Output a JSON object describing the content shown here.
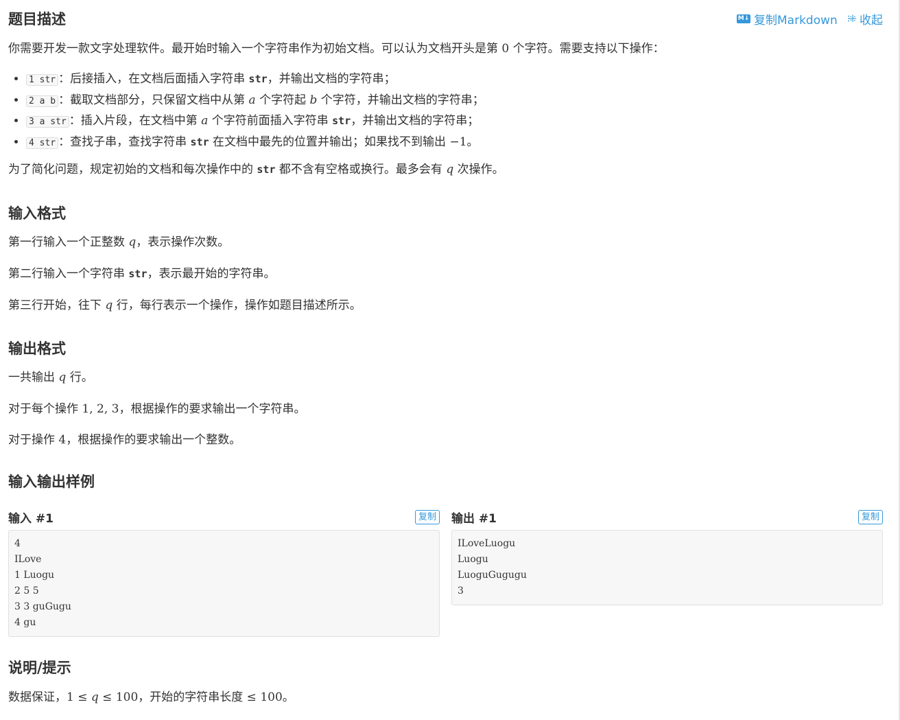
{
  "toolbar": {
    "copy_markdown": "复制Markdown",
    "collapse": "收起"
  },
  "desc": {
    "title": "题目描述",
    "intro": [
      "你需要开发一款文字处理软件。最开始时输入一个字符串作为初始文档。可以认为文档开头是第 ",
      "0",
      " 个字符。需要支持以下操作："
    ],
    "ops": [
      {
        "code": "1 str",
        "parts": [
          "：后接插入，在文档后面插入字符串 ",
          "str",
          "，并输出文档的字符串；"
        ]
      },
      {
        "code": "2 a b",
        "parts": [
          "：截取文档部分，只保留文档中从第 ",
          "a",
          " 个字符起 ",
          "b",
          " 个字符，并输出文档的字符串；"
        ]
      },
      {
        "code": "3 a str",
        "parts": [
          "：插入片段，在文档中第 ",
          "a",
          " 个字符前面插入字符串 ",
          "str",
          "，并输出文档的字符串；"
        ]
      },
      {
        "code": "4 str",
        "parts": [
          "：查找子串，查找字符串 ",
          "str",
          " 在文档中最先的位置并输出；如果找不到输出 ",
          "−1",
          "。"
        ]
      }
    ],
    "note": [
      "为了简化问题，规定初始的文档和每次操作中的 ",
      "str",
      " 都不含有空格或换行。最多会有 ",
      "q",
      " 次操作。"
    ]
  },
  "input_format": {
    "title": "输入格式",
    "l1": [
      "第一行输入一个正整数 ",
      "q",
      "，表示操作次数。"
    ],
    "l2": [
      "第二行输入一个字符串 ",
      "str",
      "，表示最开始的字符串。"
    ],
    "l3": [
      "第三行开始，往下 ",
      "q",
      " 行，每行表示一个操作，操作如题目描述所示。"
    ]
  },
  "output_format": {
    "title": "输出格式",
    "l1": [
      "一共输出 ",
      "q",
      " 行。"
    ],
    "l2": [
      "对于每个操作 ",
      "1, 2, 3",
      "，根据操作的要求输出一个字符串。"
    ],
    "l3": [
      "对于操作 ",
      "4",
      "，根据操作的要求输出一个整数。"
    ]
  },
  "samples": {
    "title": "输入输出样例",
    "input_label": "输入 #1",
    "output_label": "输出 #1",
    "copy_label": "复制",
    "input_text": "4\nILove\n1 Luogu\n2 5 5\n3 3 guGugu\n4 gu",
    "output_text": "ILoveLuogu\nLuogu\nLuoguGugugu\n3"
  },
  "hint": {
    "title": "说明/提示",
    "parts": [
      "数据保证，",
      "1 ≤ ",
      "q",
      " ≤ 100",
      "，开始的字符串长度 ",
      "≤ 100",
      "。"
    ]
  }
}
